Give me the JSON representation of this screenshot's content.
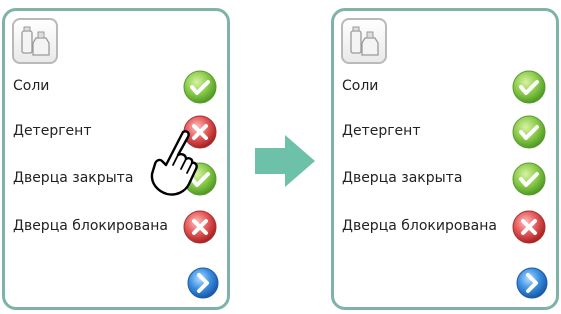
{
  "panels": [
    {
      "id": "before",
      "rows": [
        {
          "label": "Соли",
          "status": "ok"
        },
        {
          "label": "Детергент",
          "status": "error"
        },
        {
          "label": "Дверца закрыта",
          "status": "ok"
        },
        {
          "label": "Дверца блокирована",
          "status": "error"
        }
      ]
    },
    {
      "id": "after",
      "rows": [
        {
          "label": "Соли",
          "status": "ok"
        },
        {
          "label": "Детергент",
          "status": "ok"
        },
        {
          "label": "Дверца закрыта",
          "status": "ok"
        },
        {
          "label": "Дверца блокирована",
          "status": "error"
        }
      ]
    }
  ],
  "icons": {
    "app": "salt-detergent-icon",
    "ok": "check-icon",
    "error": "cross-icon",
    "next": "chevron-right-icon",
    "transition": "arrow-right-icon",
    "pointer": "hand-pointer-icon"
  },
  "colors": {
    "panel_border": "#7fb3a8",
    "ok_green": "#7cc043",
    "error_red": "#e04848",
    "next_blue": "#2d7fd3",
    "arrow": "#6cc1a8"
  }
}
